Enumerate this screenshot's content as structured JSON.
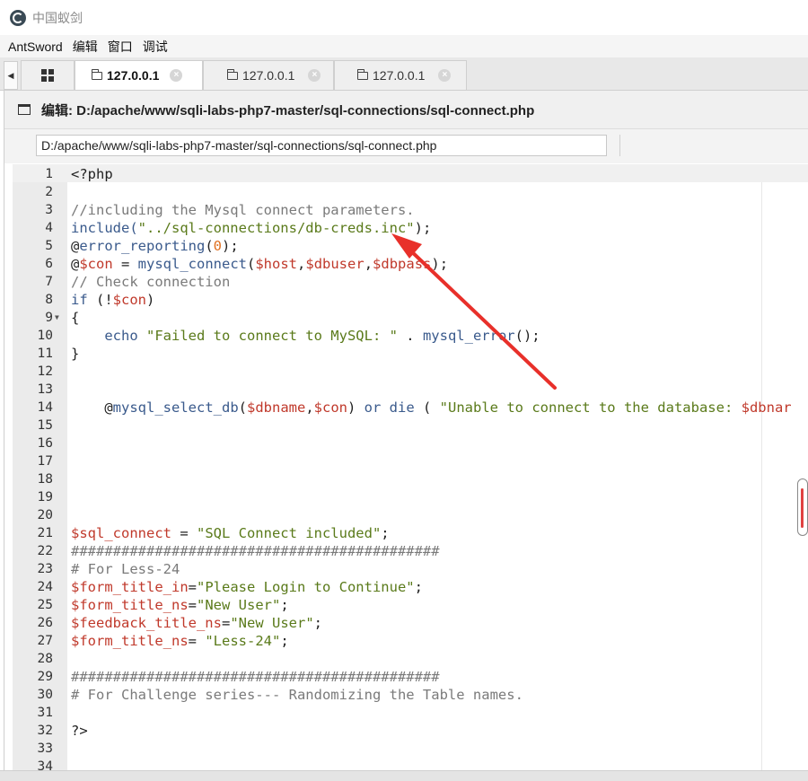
{
  "window": {
    "title": "中国蚁剑"
  },
  "menu": [
    "AntSword",
    "编辑",
    "窗口",
    "调试"
  ],
  "tabs": [
    {
      "label": "127.0.0.1",
      "active": true
    },
    {
      "label": "127.0.0.1",
      "active": false
    },
    {
      "label": "127.0.0.1",
      "active": false
    }
  ],
  "tab_close_glyph": "×",
  "tab_scroll_glyph": "◀",
  "editor_panel": {
    "title": "编辑: D:/apache/www/sqli-labs-php7-master/sql-connections/sql-connect.php",
    "path_value": "D:/apache/www/sqli-labs-php7-master/sql-connections/sql-connect.php"
  },
  "fold_marker": "▼",
  "code_lines": [
    {
      "n": "1",
      "segs": [
        {
          "t": "<?php",
          "c": "c-plain"
        }
      ]
    },
    {
      "n": "2",
      "segs": []
    },
    {
      "n": "3",
      "segs": [
        {
          "t": "//including the Mysql connect parameters.",
          "c": "c-comment"
        }
      ]
    },
    {
      "n": "4",
      "segs": [
        {
          "t": "include(",
          "c": "c-fn"
        },
        {
          "t": "\"../sql-connections/db-creds.inc\"",
          "c": "c-str"
        },
        {
          "t": ");",
          "c": "c-plain"
        }
      ]
    },
    {
      "n": "5",
      "segs": [
        {
          "t": "@",
          "c": "c-plain"
        },
        {
          "t": "error_reporting",
          "c": "c-fn"
        },
        {
          "t": "(",
          "c": "c-plain"
        },
        {
          "t": "0",
          "c": "c-num"
        },
        {
          "t": ");",
          "c": "c-plain"
        }
      ]
    },
    {
      "n": "6",
      "segs": [
        {
          "t": "@",
          "c": "c-plain"
        },
        {
          "t": "$con",
          "c": "c-var"
        },
        {
          "t": " = ",
          "c": "c-plain"
        },
        {
          "t": "mysql_connect",
          "c": "c-fn"
        },
        {
          "t": "(",
          "c": "c-plain"
        },
        {
          "t": "$host",
          "c": "c-var"
        },
        {
          "t": ",",
          "c": "c-plain"
        },
        {
          "t": "$dbuser",
          "c": "c-var"
        },
        {
          "t": ",",
          "c": "c-plain"
        },
        {
          "t": "$dbpass",
          "c": "c-var"
        },
        {
          "t": ");",
          "c": "c-plain"
        }
      ]
    },
    {
      "n": "7",
      "segs": [
        {
          "t": "// Check connection",
          "c": "c-comment"
        }
      ]
    },
    {
      "n": "8",
      "segs": [
        {
          "t": "if",
          "c": "c-kw"
        },
        {
          "t": " (!",
          "c": "c-plain"
        },
        {
          "t": "$con",
          "c": "c-var"
        },
        {
          "t": ")",
          "c": "c-plain"
        }
      ]
    },
    {
      "n": "9",
      "fold": true,
      "segs": [
        {
          "t": "{",
          "c": "c-plain"
        }
      ]
    },
    {
      "n": "10",
      "segs": [
        {
          "t": "    echo ",
          "c": "c-kw"
        },
        {
          "t": "\"Failed to connect to MySQL: \"",
          "c": "c-str"
        },
        {
          "t": " . ",
          "c": "c-plain"
        },
        {
          "t": "mysql_error",
          "c": "c-fn"
        },
        {
          "t": "();",
          "c": "c-plain"
        }
      ]
    },
    {
      "n": "11",
      "segs": [
        {
          "t": "}",
          "c": "c-plain"
        }
      ]
    },
    {
      "n": "12",
      "segs": []
    },
    {
      "n": "13",
      "segs": []
    },
    {
      "n": "14",
      "segs": [
        {
          "t": "    @",
          "c": "c-plain"
        },
        {
          "t": "mysql_select_db",
          "c": "c-fn"
        },
        {
          "t": "(",
          "c": "c-plain"
        },
        {
          "t": "$dbname",
          "c": "c-var"
        },
        {
          "t": ",",
          "c": "c-plain"
        },
        {
          "t": "$con",
          "c": "c-var"
        },
        {
          "t": ") ",
          "c": "c-plain"
        },
        {
          "t": "or die",
          "c": "c-kw"
        },
        {
          "t": " ( ",
          "c": "c-plain"
        },
        {
          "t": "\"Unable to connect to the database: ",
          "c": "c-str"
        },
        {
          "t": "$dbnar",
          "c": "c-var"
        }
      ]
    },
    {
      "n": "15",
      "segs": []
    },
    {
      "n": "16",
      "segs": []
    },
    {
      "n": "17",
      "segs": []
    },
    {
      "n": "18",
      "segs": []
    },
    {
      "n": "19",
      "segs": []
    },
    {
      "n": "20",
      "segs": []
    },
    {
      "n": "21",
      "segs": [
        {
          "t": "$sql_connect",
          "c": "c-var"
        },
        {
          "t": " = ",
          "c": "c-plain"
        },
        {
          "t": "\"SQL Connect included\"",
          "c": "c-str"
        },
        {
          "t": ";",
          "c": "c-plain"
        }
      ]
    },
    {
      "n": "22",
      "segs": [
        {
          "t": "############################################",
          "c": "c-comment"
        }
      ]
    },
    {
      "n": "23",
      "segs": [
        {
          "t": "# For Less-24",
          "c": "c-comment"
        }
      ]
    },
    {
      "n": "24",
      "segs": [
        {
          "t": "$form_title_in",
          "c": "c-var"
        },
        {
          "t": "=",
          "c": "c-plain"
        },
        {
          "t": "\"Please Login to Continue\"",
          "c": "c-str"
        },
        {
          "t": ";",
          "c": "c-plain"
        }
      ]
    },
    {
      "n": "25",
      "segs": [
        {
          "t": "$form_title_ns",
          "c": "c-var"
        },
        {
          "t": "=",
          "c": "c-plain"
        },
        {
          "t": "\"New User\"",
          "c": "c-str"
        },
        {
          "t": ";",
          "c": "c-plain"
        }
      ]
    },
    {
      "n": "26",
      "segs": [
        {
          "t": "$feedback_title_ns",
          "c": "c-var"
        },
        {
          "t": "=",
          "c": "c-plain"
        },
        {
          "t": "\"New User\"",
          "c": "c-str"
        },
        {
          "t": ";",
          "c": "c-plain"
        }
      ]
    },
    {
      "n": "27",
      "segs": [
        {
          "t": "$form_title_ns",
          "c": "c-var"
        },
        {
          "t": "= ",
          "c": "c-plain"
        },
        {
          "t": "\"Less-24\"",
          "c": "c-str"
        },
        {
          "t": ";",
          "c": "c-plain"
        }
      ]
    },
    {
      "n": "28",
      "segs": []
    },
    {
      "n": "29",
      "segs": [
        {
          "t": "############################################",
          "c": "c-comment"
        }
      ]
    },
    {
      "n": "30",
      "segs": [
        {
          "t": "# For Challenge series--- Randomizing the Table names.",
          "c": "c-comment"
        }
      ]
    },
    {
      "n": "31",
      "segs": []
    },
    {
      "n": "32",
      "segs": [
        {
          "t": "?>",
          "c": "c-plain"
        }
      ]
    },
    {
      "n": "33",
      "segs": []
    },
    {
      "n": "34",
      "segs": []
    }
  ]
}
